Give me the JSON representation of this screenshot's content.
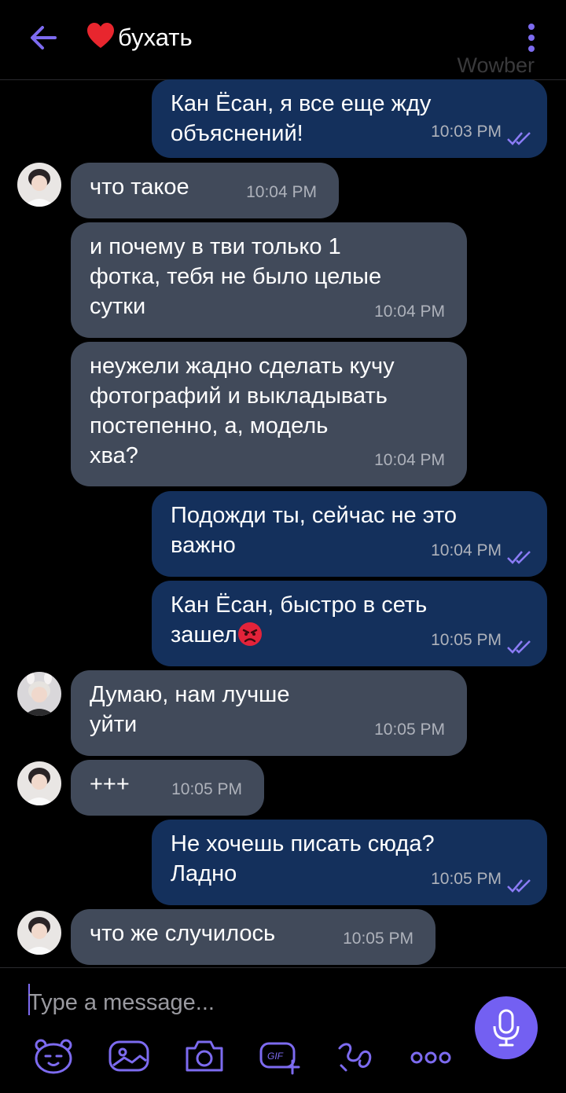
{
  "header": {
    "title": "бухать",
    "watermark": "Wowber"
  },
  "messages": [
    {
      "dir": "out",
      "text": "Кан Ёсан, я все еще жду\nобъяснений!",
      "time": "10:03 PM"
    },
    {
      "dir": "in",
      "text": "что такое",
      "time": "10:04 PM"
    },
    {
      "dir": "in",
      "text": "и почему в тви только 1\nфотка, тебя не было целые\nсутки",
      "time": "10:04 PM"
    },
    {
      "dir": "in",
      "text": "неужели жадно сделать кучу\nфотографий и выкладывать\nпостепенно, а, модель\nхва?",
      "time": "10:04 PM"
    },
    {
      "dir": "out",
      "text": "Подожди ты, сейчас не это\nважно",
      "time": "10:04 PM"
    },
    {
      "dir": "out",
      "text": "Кан Ёсан, быстро в сеть\nзашел",
      "time": "10:05 PM"
    },
    {
      "dir": "in",
      "text": "Думаю, нам лучше\nуйти",
      "time": "10:05 PM"
    },
    {
      "dir": "in",
      "text": "+++",
      "time": "10:05 PM"
    },
    {
      "dir": "out",
      "text": "Не хочешь писать сюда?\nЛадно",
      "time": "10:05 PM"
    },
    {
      "dir": "in",
      "text": "что же случилось",
      "time": "10:05 PM"
    }
  ],
  "composer": {
    "placeholder": "Type a message..."
  },
  "colors": {
    "outgoing_bubble": "#14305c",
    "incoming_bubble": "#414a5a",
    "accent": "#7360f2"
  }
}
